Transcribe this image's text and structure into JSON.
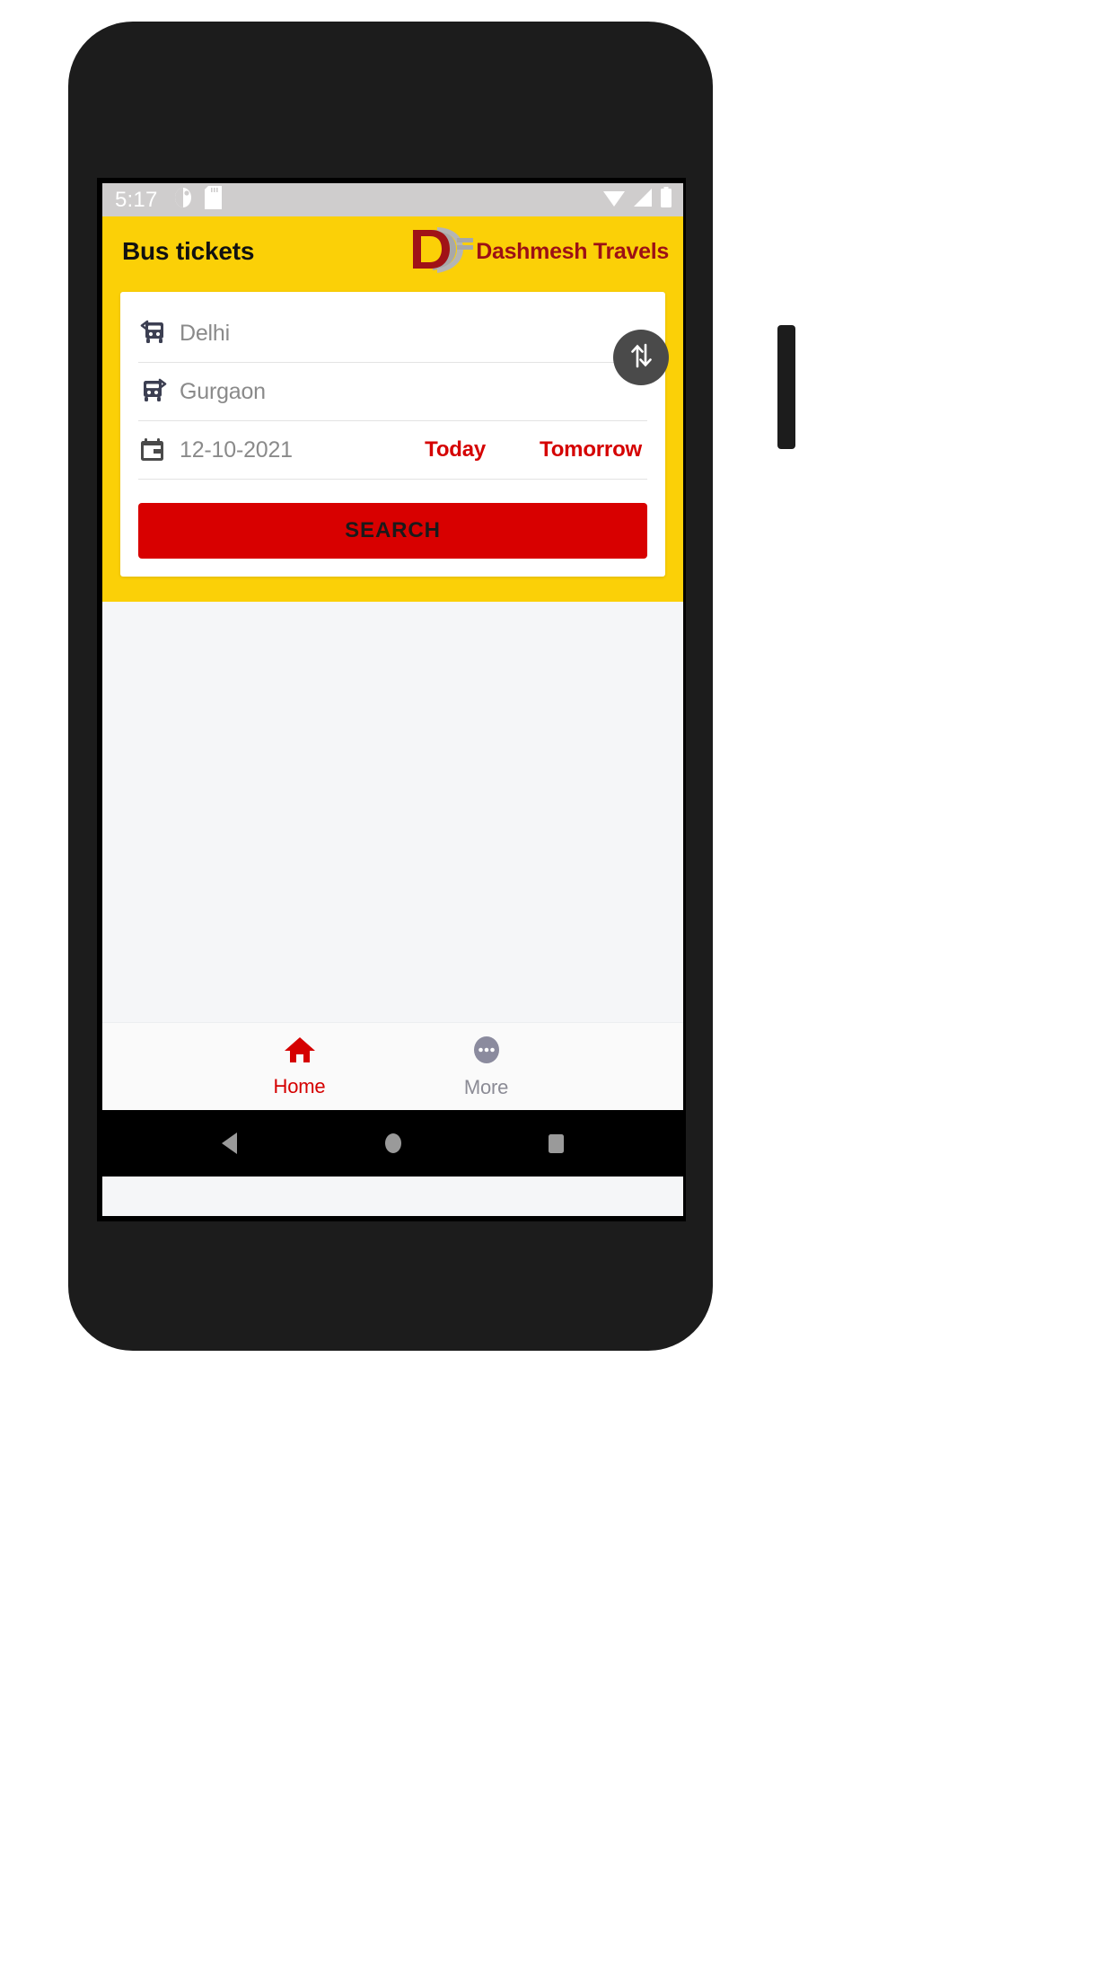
{
  "status_bar": {
    "time": "5:17",
    "left_icons": [
      "dnd-icon",
      "sd-card-icon"
    ],
    "right_icons": [
      "wifi-icon",
      "cellular-signal-icon",
      "battery-icon"
    ],
    "background_color": "#cfcdcd"
  },
  "header": {
    "title": "Bus tickets",
    "brand_name": "Dashmesh Travels",
    "brand_mark": "logo-d-swoosh-icon",
    "background_color": "#fbd007",
    "brand_color": "#9c1016"
  },
  "search_form": {
    "origin": {
      "icon": "bus-departure-icon",
      "value": "Delhi",
      "placeholder": "From"
    },
    "destination": {
      "icon": "bus-arrival-icon",
      "value": "Gurgaon",
      "placeholder": "To"
    },
    "date": {
      "icon": "calendar-icon",
      "value": "12-10-2021",
      "placeholder": "Select date"
    },
    "quick_dates": [
      {
        "label": "Today"
      },
      {
        "label": "Tomorrow"
      }
    ],
    "swap_button": {
      "icon": "swap-vertical-icon",
      "color": "#4a4a4a"
    },
    "submit": {
      "label": "SEARCH",
      "color": "#d80000"
    }
  },
  "bottom_nav": {
    "items": [
      {
        "label": "Home",
        "icon": "home-icon",
        "active": true,
        "color": "#d50000"
      },
      {
        "label": "More",
        "icon": "more-dots-icon",
        "active": false,
        "color": "#8b8b95"
      }
    ]
  },
  "android_nav": {
    "items": [
      {
        "name": "back",
        "icon": "back-triangle-icon"
      },
      {
        "name": "home",
        "icon": "home-circle-icon"
      },
      {
        "name": "recents",
        "icon": "recents-square-icon"
      }
    ]
  }
}
